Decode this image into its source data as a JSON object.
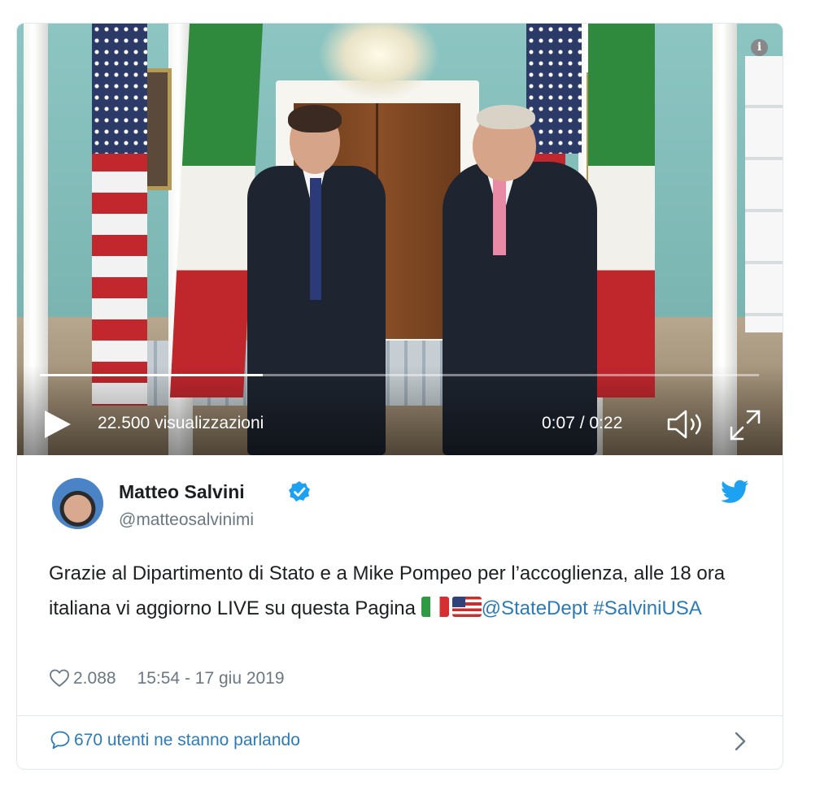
{
  "video": {
    "views_label": "22.500 visualizzazioni",
    "time_label": "0:07 / 0:22",
    "progress": 0.31,
    "icons": [
      "play-icon",
      "volume-icon",
      "fullscreen-icon",
      "info-icon"
    ]
  },
  "tweet": {
    "author_name": "Matteo Salvini",
    "author_handle": "@matteosalvinimi",
    "text_part1": "Grazie al Dipartimento di Stato e a Mike Pompeo per l’accoglienza, alle 18 ora italiana vi aggiorno LIVE su questa Pagina ",
    "mention": "@StateDept",
    "hashtag": "#SalviniUSA",
    "likes": "2.088",
    "timestamp": "15:54 - 17 giu 2019",
    "conversation": "670 utenti ne stanno parlando"
  },
  "colors": {
    "link": "#2b7bb9",
    "muted": "#697882",
    "twitter_blue": "#1da1f2",
    "border": "#e1e8ed"
  }
}
